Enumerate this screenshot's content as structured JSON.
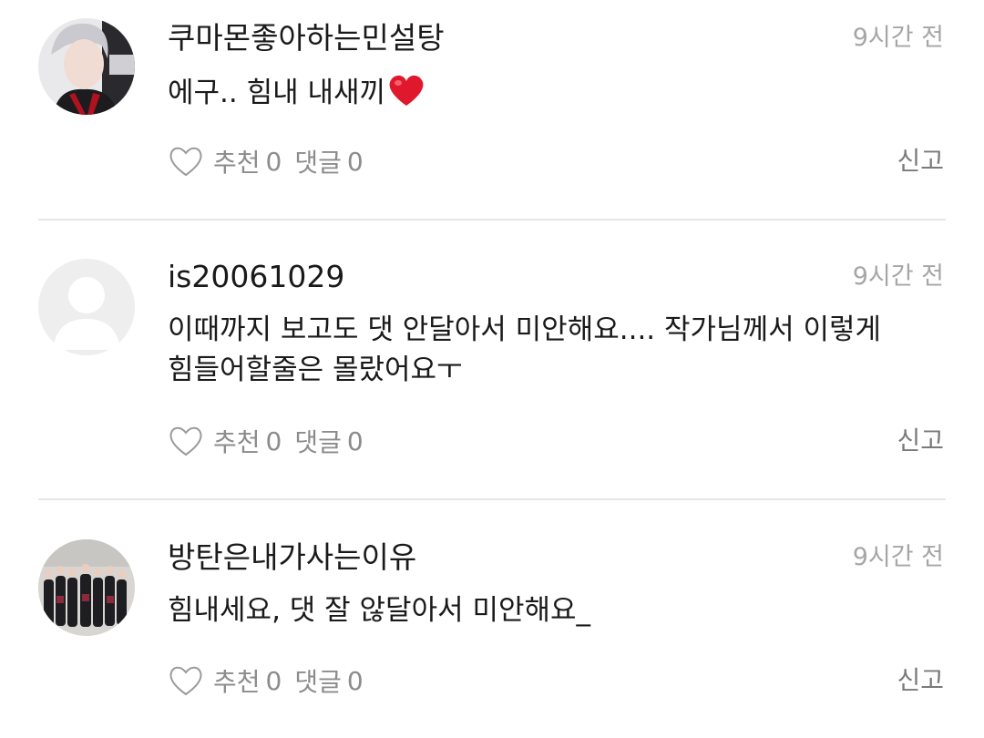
{
  "comments": [
    {
      "username": "쿠마몬좋아하는민설탕",
      "time": "9시간 전",
      "text": "에구.. 힘내 내새끼",
      "emoji": "heart-emoji",
      "like_label": "추천",
      "like_count": "0",
      "reply_label": "댓글",
      "reply_count": "0",
      "report_label": "신고",
      "avatar": "photo-avatar"
    },
    {
      "username": "is20061029",
      "time": "9시간 전",
      "text_line1": "이때까지 보고도 댓 안달아서 미안해요.... 작가님께서 이렇게",
      "text_line2": "힘들어할줄은 몰랐어요ㅜ",
      "like_label": "추천",
      "like_count": "0",
      "reply_label": "댓글",
      "reply_count": "0",
      "report_label": "신고",
      "avatar": "default-user-avatar"
    },
    {
      "username": "방탄은내가사는이유",
      "time": "9시간 전",
      "text": "힘내세요, 댓 잘 않달아서 미안해요_",
      "like_label": "추천",
      "like_count": "0",
      "reply_label": "댓글",
      "reply_count": "0",
      "report_label": "신고",
      "avatar": "group-photo-avatar"
    }
  ],
  "colors": {
    "text": "#1a1a1a",
    "muted": "#8c8c8c",
    "time": "#a6a6a6",
    "divider": "#e6e6e6",
    "heart": "#e0182d"
  }
}
